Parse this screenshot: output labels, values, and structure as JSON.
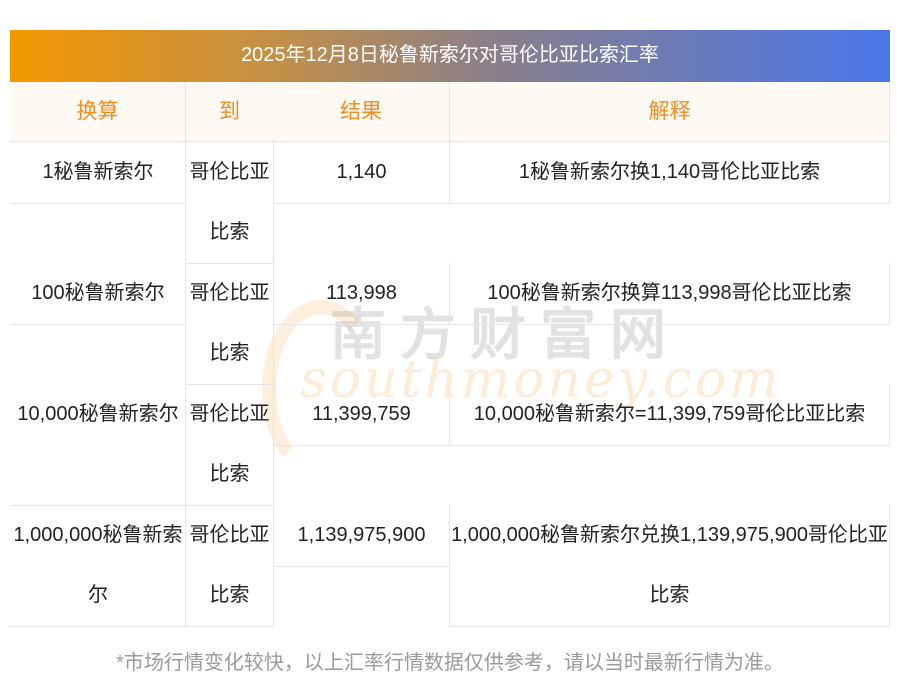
{
  "title": "2025年12月8日秘鲁新索尔对哥伦比亚比索汇率",
  "headers": [
    "换算",
    "到",
    "结果",
    "解释"
  ],
  "rows": [
    {
      "from": "1秘鲁新索尔",
      "to": "哥伦比亚比索",
      "result": "1,140",
      "explain": "1秘鲁新索尔换1,140哥伦比亚比索"
    },
    {
      "from": "100秘鲁新索尔",
      "to": "哥伦比亚比索",
      "result": "113,998",
      "explain": "100秘鲁新索尔换算113,998哥伦比亚比索"
    },
    {
      "from": "10,000秘鲁新索尔",
      "to": "哥伦比亚比索",
      "result": "11,399,759",
      "explain": "10,000秘鲁新索尔=11,399,759哥伦比亚比索"
    },
    {
      "from": "1,000,000秘鲁新索尔",
      "to": "哥伦比亚比索",
      "result": "1,139,975,900",
      "explain": "1,000,000秘鲁新索尔兑换1,139,975,900哥伦比亚比索"
    }
  ],
  "watermark": {
    "cn": "南方财富网",
    "en": "southmoney.com"
  },
  "footer": "*市场行情变化较快，以上汇率行情数据仅供参考，请以当时最新行情为准。"
}
